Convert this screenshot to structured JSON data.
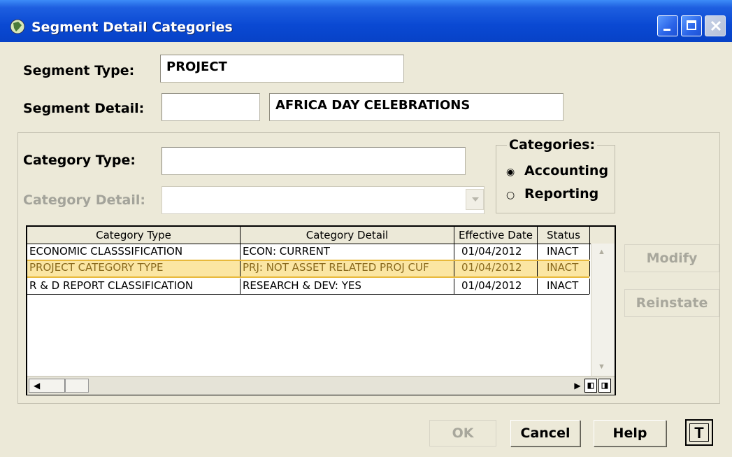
{
  "window": {
    "title": "Segment Detail Categories",
    "icons": {
      "app": "app-icon",
      "minimize": "minimize-icon",
      "maximize": "maximize-icon",
      "close": "close-icon"
    }
  },
  "form": {
    "segment_type_label": "Segment Type:",
    "segment_type_value": "PROJECT",
    "segment_detail_label": "Segment Detail:",
    "segment_detail_code": "",
    "segment_detail_value": "AFRICA DAY CELEBRATIONS",
    "category_type_label": "Category Type:",
    "category_type_value": "",
    "category_detail_label": "Category Detail:",
    "category_detail_value": ""
  },
  "categories": {
    "legend": "Categories:",
    "options": [
      {
        "label": "Accounting",
        "selected": true
      },
      {
        "label": "Reporting",
        "selected": false
      }
    ]
  },
  "grid": {
    "columns": [
      "Category Type",
      "Category Detail",
      "Effective Date",
      "Status"
    ],
    "rows": [
      [
        "ECONOMIC CLASSSIFICATION",
        "ECON: CURRENT",
        "01/04/2012",
        "INACT"
      ],
      [
        "PROJECT CATEGORY TYPE",
        "PRJ: NOT ASSET RELATED PROJ CUF",
        "01/04/2012",
        "INACT"
      ],
      [
        "R & D REPORT CLASSIFICATION",
        "RESEARCH & DEV: YES",
        "01/04/2012",
        "INACT"
      ]
    ],
    "selected_row": 1
  },
  "side_buttons": {
    "modify": "Modify",
    "reinstate": "Reinstate"
  },
  "footer_buttons": {
    "ok": "OK",
    "cancel": "Cancel",
    "help": "Help",
    "t": "T"
  },
  "colors": {
    "titlebar": "#0a49d3",
    "window_bg": "#ece9d8",
    "selection": "#fbe6a3"
  }
}
